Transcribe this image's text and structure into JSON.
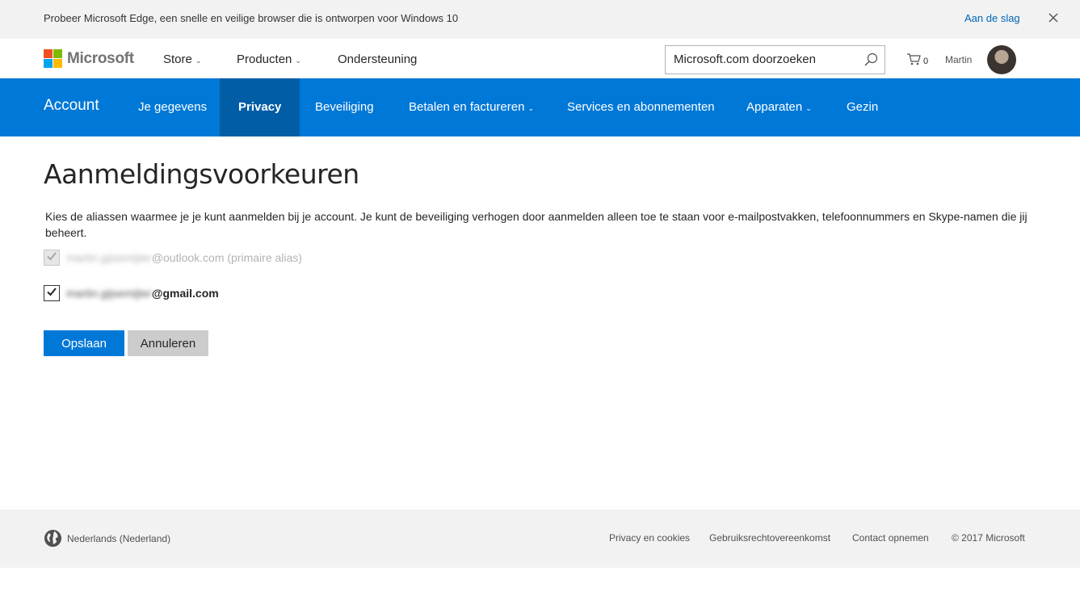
{
  "banner": {
    "text": "Probeer Microsoft Edge, een snelle en veilige browser die is ontworpen voor Windows 10",
    "link": "Aan de slag"
  },
  "header": {
    "brand": "Microsoft",
    "nav": [
      {
        "label": "Store"
      },
      {
        "label": "Producten"
      },
      {
        "label": "Ondersteuning"
      }
    ],
    "search_placeholder": "Microsoft.com doorzoeken",
    "cart_count": "0",
    "user_name": "Martin"
  },
  "account_nav": {
    "title": "Account",
    "items": [
      {
        "label": "Je gegevens"
      },
      {
        "label": "Privacy"
      },
      {
        "label": "Beveiliging"
      },
      {
        "label": "Betalen en factureren"
      },
      {
        "label": "Services en abonnementen"
      },
      {
        "label": "Apparaten"
      },
      {
        "label": "Gezin"
      }
    ]
  },
  "main": {
    "title": "Aanmeldingsvoorkeuren",
    "description": "Kies de aliassen waarmee je je kunt aanmelden bij je account. Je kunt de beveiliging verhogen door aanmelden alleen toe te staan voor e-mailpostvakken, telefoonnummers en Skype-namen die jij beheert.",
    "aliases": [
      {
        "redacted": "martin.gijsemijter",
        "domain": "@outlook.com (primaire alias)",
        "checked": true,
        "disabled": true
      },
      {
        "redacted": "martin.gijsemijter",
        "domain": "@gmail.com",
        "checked": true,
        "disabled": false
      }
    ],
    "save_label": "Opslaan",
    "cancel_label": "Annuleren"
  },
  "footer": {
    "locale": "Nederlands (Nederland)",
    "links": [
      "Privacy en cookies",
      "Gebruiksrechtovereenkomst",
      "Contact opnemen"
    ],
    "copyright": "© 2017 Microsoft"
  },
  "colors": {
    "accent": "#0078d7",
    "accent_active": "#005da6",
    "banner_bg": "#f2f2f2"
  }
}
